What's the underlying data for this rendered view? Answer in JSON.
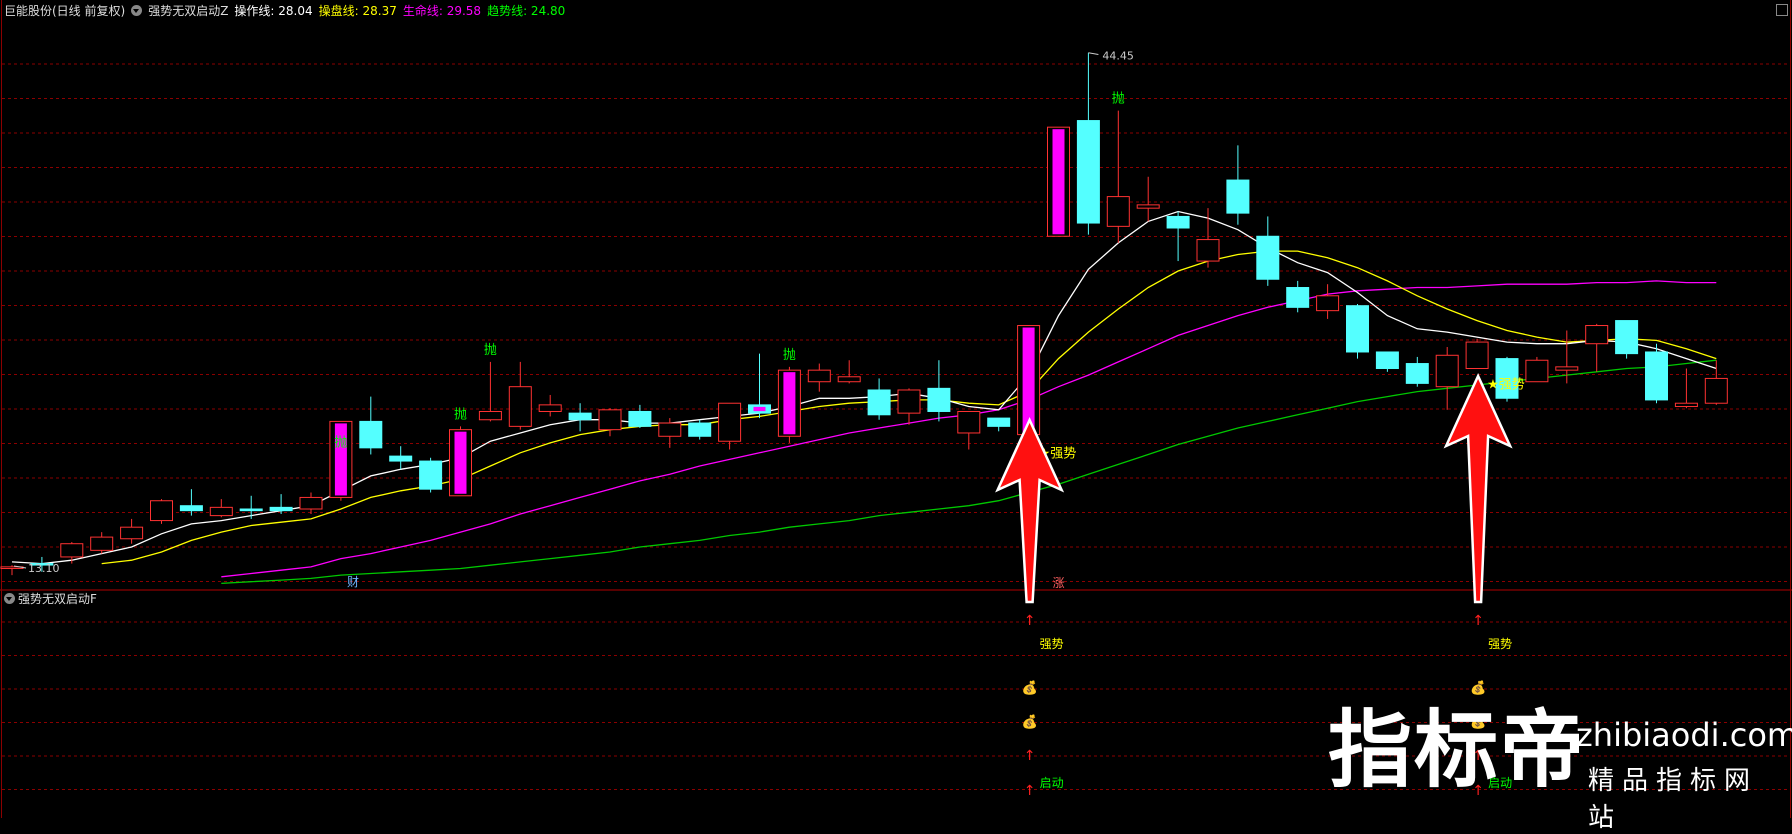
{
  "header": {
    "stock_name": "巨能股份(日线 前复权)",
    "indicator_name": "强势无双启动Z",
    "items": [
      {
        "label": "操作线: 28.04",
        "color": "#ffffff"
      },
      {
        "label": "操盘线: 28.37",
        "color": "#ffff00"
      },
      {
        "label": "生命线: 29.58",
        "color": "#ff00ff"
      },
      {
        "label": "趋势线: 24.80",
        "color": "#00ff00"
      }
    ]
  },
  "sub_panel": {
    "title": "强势无双启动F"
  },
  "price_labels": {
    "high": "44.45",
    "low": "13.10"
  },
  "markers": {
    "throw": "抛",
    "strong": "★强势",
    "cai": "财",
    "zhang": "涨",
    "strong_sub": "强势",
    "start": "启动",
    "up_arrow": "↑",
    "money": "💰"
  },
  "watermark": {
    "big": "指标帝",
    "url": "zhibiaodi.com",
    "sub": "精品指标网站"
  },
  "colors": {
    "up": "#ff3232",
    "down": "#54ffff",
    "grid": "#8b0000",
    "operate": "#ffffff",
    "trader": "#ffff00",
    "life": "#ff00ff",
    "trend": "#00c800"
  },
  "chart_data": {
    "type": "candlestick",
    "ylim": [
      12,
      46
    ],
    "series_names": [
      "操作线",
      "操盘线",
      "生命线",
      "趋势线"
    ],
    "candles": [
      {
        "o": 13.3,
        "h": 13.5,
        "l": 12.9,
        "c": 13.4,
        "dir": "up"
      },
      {
        "o": 13.6,
        "h": 14.0,
        "l": 13.1,
        "c": 13.6,
        "dir": "down"
      },
      {
        "o": 14.0,
        "h": 14.9,
        "l": 13.6,
        "c": 14.8,
        "dir": "up"
      },
      {
        "o": 14.4,
        "h": 15.5,
        "l": 14.2,
        "c": 15.2,
        "dir": "up"
      },
      {
        "o": 15.1,
        "h": 16.3,
        "l": 14.8,
        "c": 15.8,
        "dir": "up"
      },
      {
        "o": 16.2,
        "h": 17.5,
        "l": 16.0,
        "c": 17.4,
        "dir": "up"
      },
      {
        "o": 17.1,
        "h": 18.1,
        "l": 16.5,
        "c": 16.8,
        "dir": "down"
      },
      {
        "o": 16.5,
        "h": 17.5,
        "l": 16.4,
        "c": 17.0,
        "dir": "up"
      },
      {
        "o": 16.8,
        "h": 17.7,
        "l": 16.3,
        "c": 16.9,
        "dir": "down"
      },
      {
        "o": 17.0,
        "h": 17.8,
        "l": 16.6,
        "c": 16.8,
        "dir": "down"
      },
      {
        "o": 16.9,
        "h": 17.9,
        "l": 16.6,
        "c": 17.6,
        "dir": "up"
      },
      {
        "o": 17.6,
        "h": 20.2,
        "l": 17.4,
        "c": 22.2,
        "dir": "up"
      },
      {
        "o": 22.2,
        "h": 23.7,
        "l": 20.2,
        "c": 20.6,
        "dir": "down"
      },
      {
        "o": 20.1,
        "h": 20.7,
        "l": 19.3,
        "c": 19.8,
        "dir": "down"
      },
      {
        "o": 19.8,
        "h": 20.0,
        "l": 17.9,
        "c": 18.1,
        "dir": "down"
      },
      {
        "o": 17.7,
        "h": 21.9,
        "l": 17.7,
        "c": 21.7,
        "dir": "up"
      },
      {
        "o": 22.3,
        "h": 25.8,
        "l": 22.2,
        "c": 22.8,
        "dir": "up"
      },
      {
        "o": 21.9,
        "h": 25.8,
        "l": 21.7,
        "c": 24.3,
        "dir": "up"
      },
      {
        "o": 22.8,
        "h": 23.8,
        "l": 22.5,
        "c": 23.2,
        "dir": "up"
      },
      {
        "o": 22.7,
        "h": 23.3,
        "l": 21.6,
        "c": 22.3,
        "dir": "down"
      },
      {
        "o": 21.7,
        "h": 23.0,
        "l": 21.3,
        "c": 22.9,
        "dir": "up"
      },
      {
        "o": 22.8,
        "h": 23.2,
        "l": 21.8,
        "c": 21.9,
        "dir": "down"
      },
      {
        "o": 21.3,
        "h": 22.4,
        "l": 20.6,
        "c": 22.1,
        "dir": "up"
      },
      {
        "o": 22.1,
        "h": 22.3,
        "l": 21.1,
        "c": 21.3,
        "dir": "down"
      },
      {
        "o": 21.0,
        "h": 23.3,
        "l": 20.5,
        "c": 23.3,
        "dir": "up"
      },
      {
        "o": 23.2,
        "h": 26.3,
        "l": 22.4,
        "c": 22.7,
        "dir": "down"
      },
      {
        "o": 21.3,
        "h": 25.5,
        "l": 20.9,
        "c": 25.3,
        "dir": "up"
      },
      {
        "o": 24.6,
        "h": 25.7,
        "l": 24.0,
        "c": 25.3,
        "dir": "up"
      },
      {
        "o": 24.6,
        "h": 25.9,
        "l": 24.5,
        "c": 24.9,
        "dir": "up"
      },
      {
        "o": 24.1,
        "h": 24.8,
        "l": 22.3,
        "c": 22.6,
        "dir": "down"
      },
      {
        "o": 22.7,
        "h": 24.2,
        "l": 22.0,
        "c": 24.1,
        "dir": "up"
      },
      {
        "o": 24.2,
        "h": 25.9,
        "l": 22.2,
        "c": 22.8,
        "dir": "down"
      },
      {
        "o": 21.5,
        "h": 22.4,
        "l": 20.5,
        "c": 22.8,
        "dir": "up"
      },
      {
        "o": 22.4,
        "h": 22.4,
        "l": 21.6,
        "c": 21.9,
        "dir": "down"
      },
      {
        "o": 21.4,
        "h": 28.0,
        "l": 21.1,
        "c": 28.0,
        "dir": "up"
      },
      {
        "o": 33.4,
        "h": 33.4,
        "l": 33.4,
        "c": 40.0,
        "dir": "up"
      },
      {
        "o": 40.4,
        "h": 44.5,
        "l": 33.5,
        "c": 34.2,
        "dir": "down"
      },
      {
        "o": 34.0,
        "h": 41.0,
        "l": 33.0,
        "c": 35.8,
        "dir": "up"
      },
      {
        "o": 35.1,
        "h": 37.0,
        "l": 34.3,
        "c": 35.3,
        "dir": "up"
      },
      {
        "o": 34.6,
        "h": 34.9,
        "l": 31.9,
        "c": 33.9,
        "dir": "down"
      },
      {
        "o": 31.9,
        "h": 35.1,
        "l": 31.5,
        "c": 33.2,
        "dir": "up"
      },
      {
        "o": 36.8,
        "h": 38.9,
        "l": 34.1,
        "c": 34.8,
        "dir": "down"
      },
      {
        "o": 33.4,
        "h": 34.6,
        "l": 30.4,
        "c": 30.8,
        "dir": "down"
      },
      {
        "o": 30.3,
        "h": 30.7,
        "l": 28.8,
        "c": 29.1,
        "dir": "down"
      },
      {
        "o": 28.9,
        "h": 30.5,
        "l": 28.4,
        "c": 29.8,
        "dir": "up"
      },
      {
        "o": 29.2,
        "h": 29.3,
        "l": 26.0,
        "c": 26.4,
        "dir": "down"
      },
      {
        "o": 26.4,
        "h": 26.4,
        "l": 25.2,
        "c": 25.4,
        "dir": "down"
      },
      {
        "o": 25.7,
        "h": 26.1,
        "l": 24.3,
        "c": 24.5,
        "dir": "down"
      },
      {
        "o": 24.3,
        "h": 26.7,
        "l": 22.9,
        "c": 26.2,
        "dir": "up"
      },
      {
        "o": 25.4,
        "h": 27.2,
        "l": 25.4,
        "c": 27.0,
        "dir": "up"
      },
      {
        "o": 26.0,
        "h": 26.1,
        "l": 23.4,
        "c": 23.6,
        "dir": "down"
      },
      {
        "o": 24.6,
        "h": 26.1,
        "l": 24.6,
        "c": 25.9,
        "dir": "up"
      },
      {
        "o": 25.3,
        "h": 27.7,
        "l": 24.5,
        "c": 25.5,
        "dir": "up"
      },
      {
        "o": 26.9,
        "h": 28.1,
        "l": 25.2,
        "c": 28.0,
        "dir": "up"
      },
      {
        "o": 28.3,
        "h": 28.3,
        "l": 26.0,
        "c": 26.3,
        "dir": "down"
      },
      {
        "o": 26.4,
        "h": 26.9,
        "l": 23.3,
        "c": 23.5,
        "dir": "down"
      },
      {
        "o": 23.1,
        "h": 25.4,
        "l": 23.0,
        "c": 23.3,
        "dir": "up"
      },
      {
        "o": 23.3,
        "h": 25.9,
        "l": 23.2,
        "c": 24.8,
        "dir": "up"
      }
    ],
    "ma_operate": [
      13.7,
      13.6,
      13.8,
      14.2,
      14.6,
      15.4,
      16.0,
      16.2,
      16.5,
      16.8,
      17.1,
      18.0,
      18.9,
      19.3,
      19.6,
      20.0,
      21.0,
      21.5,
      22.0,
      22.3,
      22.3,
      22.1,
      22.1,
      22.3,
      22.5,
      22.7,
      23.1,
      23.6,
      23.6,
      23.7,
      23.9,
      23.6,
      23.1,
      22.9,
      25.0,
      28.6,
      31.4,
      33.0,
      34.3,
      34.9,
      34.5,
      33.8,
      32.7,
      31.8,
      31.2,
      30.0,
      28.6,
      27.8,
      27.6,
      27.3,
      27.0,
      26.9,
      26.9,
      27.1,
      27.0,
      26.6,
      26.0,
      25.4
    ],
    "ma_trader": [
      null,
      null,
      null,
      13.6,
      13.8,
      14.3,
      15.0,
      15.5,
      15.9,
      16.1,
      16.3,
      16.9,
      17.6,
      18.0,
      18.3,
      18.7,
      19.5,
      20.3,
      20.9,
      21.4,
      21.7,
      21.9,
      22.0,
      22.0,
      22.3,
      22.5,
      22.8,
      23.1,
      23.3,
      23.4,
      23.5,
      23.5,
      23.3,
      23.2,
      24.0,
      26.0,
      27.6,
      29.0,
      30.3,
      31.3,
      31.9,
      32.3,
      32.5,
      32.5,
      32.1,
      31.5,
      30.7,
      29.8,
      29.0,
      28.3,
      27.7,
      27.3,
      27.0,
      27.1,
      27.2,
      27.1,
      26.6,
      26.0
    ],
    "ma_life": [
      null,
      null,
      null,
      null,
      null,
      null,
      null,
      12.8,
      13.0,
      13.2,
      13.4,
      13.9,
      14.2,
      14.6,
      15.0,
      15.5,
      16.0,
      16.6,
      17.1,
      17.6,
      18.1,
      18.6,
      19.0,
      19.5,
      19.9,
      20.3,
      20.7,
      21.1,
      21.5,
      21.8,
      22.1,
      22.4,
      22.6,
      22.9,
      23.5,
      24.3,
      25.0,
      25.8,
      26.6,
      27.4,
      28.0,
      28.6,
      29.1,
      29.5,
      29.9,
      30.1,
      30.2,
      30.3,
      30.3,
      30.4,
      30.5,
      30.5,
      30.5,
      30.6,
      30.6,
      30.7,
      30.6,
      30.6
    ],
    "ma_trend": [
      null,
      null,
      null,
      null,
      null,
      null,
      null,
      12.4,
      12.5,
      12.6,
      12.7,
      12.9,
      13.0,
      13.1,
      13.2,
      13.3,
      13.5,
      13.7,
      13.9,
      14.1,
      14.3,
      14.6,
      14.8,
      15.0,
      15.3,
      15.5,
      15.8,
      16.0,
      16.2,
      16.5,
      16.7,
      16.9,
      17.1,
      17.4,
      17.9,
      18.4,
      19.0,
      19.6,
      20.2,
      20.8,
      21.3,
      21.8,
      22.2,
      22.6,
      23.0,
      23.4,
      23.7,
      24.0,
      24.2,
      24.4,
      24.6,
      24.8,
      25.0,
      25.2,
      25.4,
      25.5,
      25.7,
      25.9
    ]
  }
}
